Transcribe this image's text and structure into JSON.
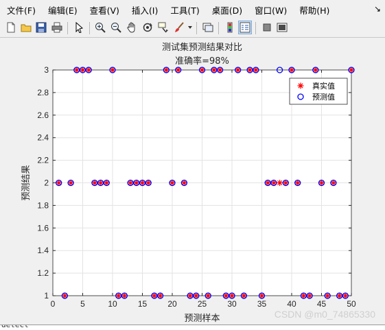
{
  "menubar": {
    "items": [
      "文件(F)",
      "编辑(E)",
      "查看(V)",
      "插入(I)",
      "工具(T)",
      "桌面(D)",
      "窗口(W)",
      "帮助(H)"
    ],
    "overflow_arrow": "↘"
  },
  "toolbar": {
    "buttons": [
      "new-file-icon",
      "open-folder-icon",
      "save-icon",
      "print-icon",
      "pointer-icon",
      "zoom-in-icon",
      "zoom-out-icon",
      "pan-icon",
      "rotate-icon",
      "data-cursor-icon",
      "brush-icon",
      "dropdown-arrow-icon",
      "link-plot-icon",
      "colorbar-icon",
      "legend-icon",
      "hide-plot-tools-icon",
      "show-plot-tools-icon"
    ]
  },
  "chart_data": {
    "type": "scatter",
    "title": "测试集预测结果对比",
    "subtitle": "准确率=98%",
    "xlabel": "预测样本",
    "ylabel": "预测结果",
    "xlim": [
      0,
      50
    ],
    "ylim": [
      1,
      3
    ],
    "xticks": [
      "0",
      "5",
      "10",
      "15",
      "20",
      "25",
      "30",
      "35",
      "40",
      "45",
      "50"
    ],
    "yticks": [
      "1",
      "1.2",
      "1.4",
      "1.6",
      "1.8",
      "2",
      "2.2",
      "2.4",
      "2.6",
      "2.8",
      "3"
    ],
    "grid": true,
    "legend_position": "top-right",
    "x": [
      1,
      2,
      3,
      4,
      5,
      6,
      7,
      8,
      9,
      10,
      11,
      12,
      13,
      14,
      15,
      16,
      17,
      18,
      19,
      20,
      21,
      22,
      23,
      24,
      25,
      26,
      27,
      28,
      29,
      30,
      31,
      32,
      33,
      34,
      35,
      36,
      37,
      38,
      39,
      40,
      41,
      42,
      43,
      44,
      45,
      46,
      47,
      48,
      49,
      50
    ],
    "series": [
      {
        "name": "真实值",
        "marker": "*",
        "color": "#ff0000",
        "values": [
          2,
          1,
          2,
          3,
          3,
          3,
          2,
          2,
          2,
          3,
          1,
          1,
          2,
          2,
          2,
          2,
          1,
          1,
          3,
          2,
          3,
          2,
          1,
          1,
          3,
          1,
          3,
          3,
          1,
          1,
          3,
          1,
          3,
          3,
          1,
          2,
          2,
          2,
          2,
          3,
          2,
          1,
          1,
          3,
          2,
          1,
          2,
          1,
          1,
          3
        ]
      },
      {
        "name": "预测值",
        "marker": "o",
        "color": "#0000ff",
        "values": [
          2,
          1,
          2,
          3,
          3,
          3,
          2,
          2,
          2,
          3,
          1,
          1,
          2,
          2,
          2,
          2,
          1,
          1,
          3,
          2,
          3,
          2,
          1,
          1,
          3,
          1,
          3,
          3,
          1,
          1,
          3,
          1,
          3,
          3,
          1,
          2,
          2,
          3,
          2,
          3,
          2,
          1,
          1,
          3,
          2,
          1,
          2,
          1,
          1,
          3
        ]
      }
    ]
  },
  "command_window": {
    "text": "detect"
  },
  "watermark": "CSDN @m0_74865330"
}
